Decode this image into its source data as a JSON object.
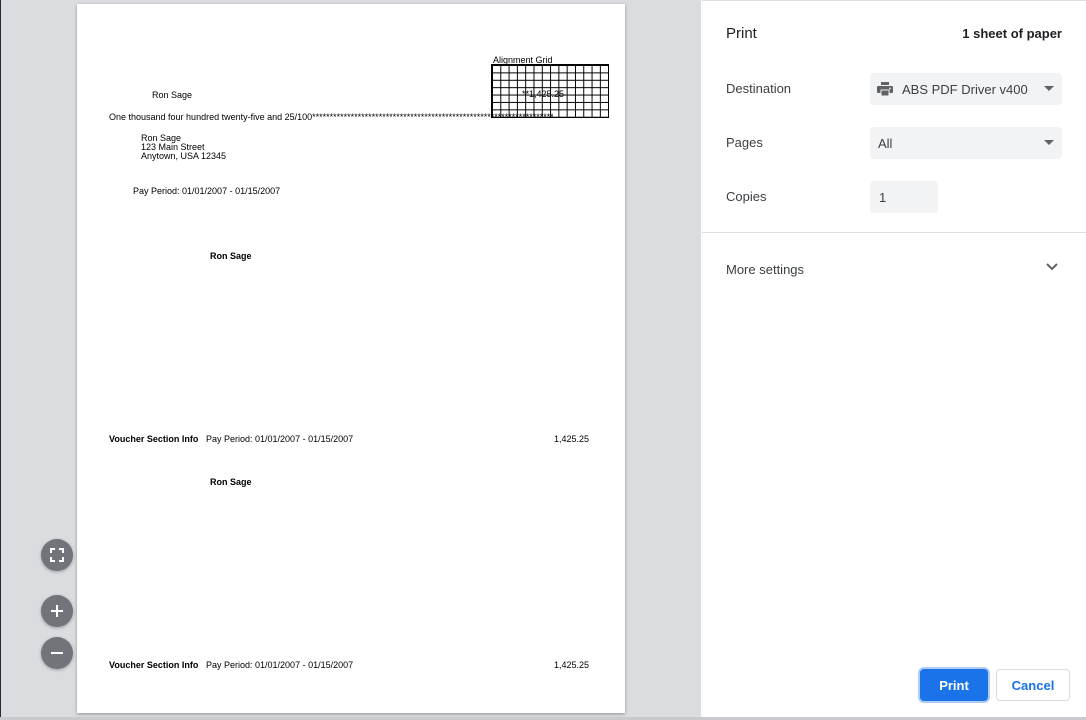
{
  "preview": {
    "alignment_grid_label": "Alignment Grid",
    "check_amount": "**1,425.25",
    "payee_name": "Ron Sage",
    "amount_in_words": "One thousand four hundred twenty-five and 25/100***********************************************************************",
    "address": {
      "name": "Ron Sage",
      "street": "123 Main Street",
      "city": "Anytown, USA 12345"
    },
    "pay_period": "Pay Period: 01/01/2007 - 01/15/2007",
    "employee_heading_1": "Ron Sage",
    "voucher_1": {
      "label": "Voucher Section Info",
      "period": "Pay Period: 01/01/2007 - 01/15/2007",
      "amount": "1,425.25"
    },
    "employee_heading_2": "Ron Sage",
    "voucher_2": {
      "label": "Voucher Section Info",
      "period": "Pay Period: 01/01/2007 - 01/15/2007",
      "amount": "1,425.25"
    }
  },
  "controls": {
    "fit_icon": "fit-to-page-icon",
    "zoom_in_icon": "zoom-in-icon",
    "zoom_out_icon": "zoom-out-icon"
  },
  "sidebar": {
    "title": "Print",
    "sheet_count": "1 sheet of paper",
    "destination_label": "Destination",
    "destination_value": "ABS PDF Driver v400",
    "destination_icon": "printer-icon",
    "pages_label": "Pages",
    "pages_value": "All",
    "copies_label": "Copies",
    "copies_value": "1",
    "more_settings": "More settings",
    "print_button": "Print",
    "cancel_button": "Cancel"
  },
  "colors": {
    "accent": "#1a73e8",
    "preview_bg": "#dadce0",
    "field_bg": "#f1f3f4"
  }
}
